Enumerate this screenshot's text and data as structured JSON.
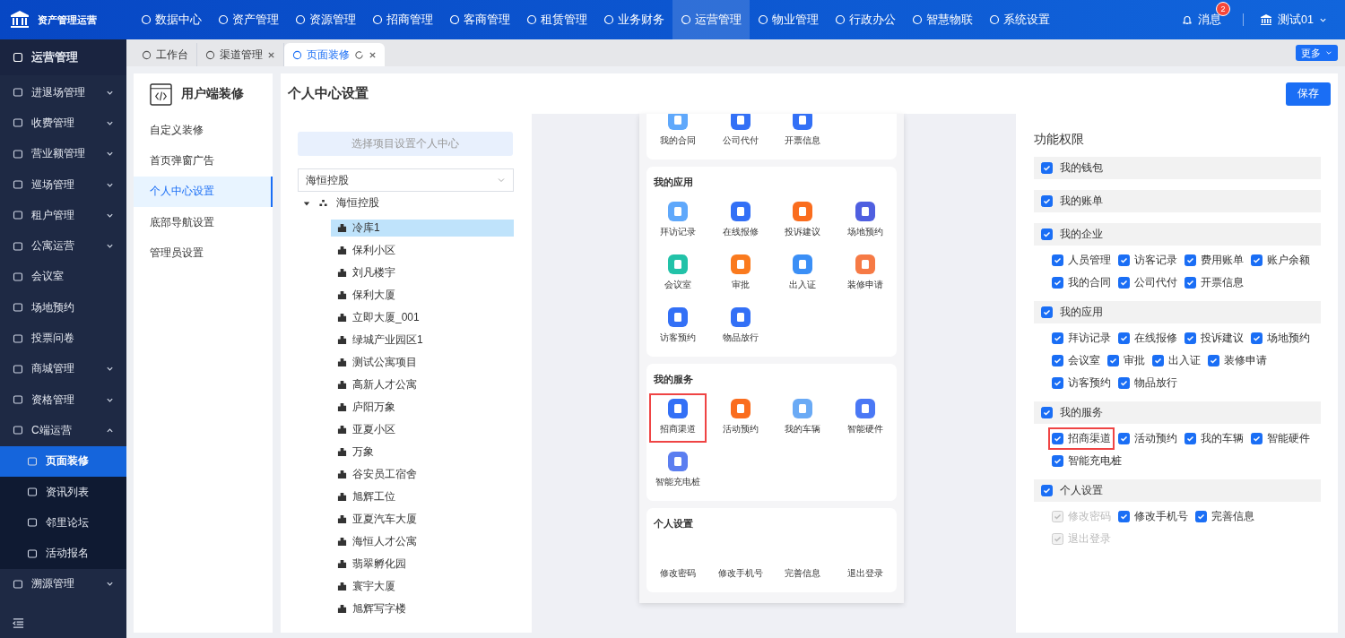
{
  "app": {
    "title": "资产管理运营"
  },
  "top_nav": [
    {
      "label": "数据中心",
      "selected": false
    },
    {
      "label": "资产管理",
      "selected": false
    },
    {
      "label": "资源管理",
      "selected": false
    },
    {
      "label": "招商管理",
      "selected": false
    },
    {
      "label": "客商管理",
      "selected": false
    },
    {
      "label": "租赁管理",
      "selected": false
    },
    {
      "label": "业务财务",
      "selected": false
    },
    {
      "label": "运营管理",
      "selected": true
    },
    {
      "label": "物业管理",
      "selected": false
    },
    {
      "label": "行政办公",
      "selected": false
    },
    {
      "label": "智慧物联",
      "selected": false
    },
    {
      "label": "系统设置",
      "selected": false
    }
  ],
  "header_right": {
    "messages": "消息",
    "badge": "2",
    "user": "测试01"
  },
  "sidebar": {
    "title": "运营管理",
    "items": [
      {
        "label": "进退场管理",
        "kind": "group",
        "expanded": false,
        "selected": false
      },
      {
        "label": "收费管理",
        "kind": "group",
        "expanded": false,
        "selected": false
      },
      {
        "label": "营业额管理",
        "kind": "group",
        "expanded": false,
        "selected": false
      },
      {
        "label": "巡场管理",
        "kind": "group",
        "expanded": false,
        "selected": false
      },
      {
        "label": "租户管理",
        "kind": "group",
        "expanded": false,
        "selected": false
      },
      {
        "label": "公寓运营",
        "kind": "group",
        "expanded": false,
        "selected": false
      },
      {
        "label": "会议室",
        "kind": "link",
        "selected": false
      },
      {
        "label": "场地预约",
        "kind": "link",
        "selected": false
      },
      {
        "label": "投票问卷",
        "kind": "link",
        "selected": false
      },
      {
        "label": "商城管理",
        "kind": "group",
        "expanded": false,
        "selected": false
      },
      {
        "label": "资格管理",
        "kind": "group",
        "expanded": false,
        "selected": false
      },
      {
        "label": "C端运营",
        "kind": "group",
        "expanded": true,
        "selected": false,
        "children": [
          {
            "label": "页面装修",
            "selected": true
          },
          {
            "label": "资讯列表",
            "selected": false
          },
          {
            "label": "邻里论坛",
            "selected": false
          },
          {
            "label": "活动报名",
            "selected": false
          }
        ]
      },
      {
        "label": "溯源管理",
        "kind": "group",
        "expanded": false,
        "selected": false
      }
    ]
  },
  "tabs": [
    {
      "label": "工作台",
      "selected": false,
      "closable": false
    },
    {
      "label": "渠道管理",
      "selected": false,
      "closable": true
    },
    {
      "label": "页面装修",
      "selected": true,
      "closable": true
    }
  ],
  "more_button": "更多",
  "decor_menu": {
    "title": "用户端装修",
    "items": [
      {
        "label": "自定义装修",
        "selected": false
      },
      {
        "label": "首页弹窗广告",
        "selected": false
      },
      {
        "label": "个人中心设置",
        "selected": true
      },
      {
        "label": "底部导航设置",
        "selected": false
      },
      {
        "label": "管理员设置",
        "selected": false
      }
    ]
  },
  "page": {
    "title": "个人中心设置",
    "save_button": "保存"
  },
  "project_panel": {
    "button": "选择项目设置个人中心",
    "select_value": "海恒控股",
    "tree": [
      {
        "label": "海恒控股",
        "expanded": true,
        "children": [
          {
            "label": "冷库1",
            "selected": true
          },
          {
            "label": "保利小区",
            "selected": false
          },
          {
            "label": "刘凡楼宇",
            "selected": false
          },
          {
            "label": "保利大厦",
            "selected": false
          },
          {
            "label": "立即大厦_001",
            "selected": false
          },
          {
            "label": "绿城产业园区1",
            "selected": false
          },
          {
            "label": "测试公寓项目",
            "selected": false
          },
          {
            "label": "高新人才公寓",
            "selected": false
          },
          {
            "label": "庐阳万象",
            "selected": false
          },
          {
            "label": "亚夏小区",
            "selected": false
          },
          {
            "label": "万象",
            "selected": false
          },
          {
            "label": "谷安员工宿舍",
            "selected": false
          },
          {
            "label": "旭辉工位",
            "selected": false
          },
          {
            "label": "亚夏汽车大厦",
            "selected": false
          },
          {
            "label": "海恒人才公寓",
            "selected": false
          },
          {
            "label": "翡翠孵化园",
            "selected": false
          },
          {
            "label": "寰宇大厦",
            "selected": false
          },
          {
            "label": "旭辉写字楼",
            "selected": false
          }
        ]
      }
    ]
  },
  "phone_preview": {
    "sections": [
      {
        "items": [
          {
            "label": "我的合同",
            "color": "#5fa8fb",
            "highlighted": false
          },
          {
            "label": "公司代付",
            "color": "#3370f6",
            "highlighted": false
          },
          {
            "label": "开票信息",
            "color": "#3370f6",
            "highlighted": false
          }
        ]
      },
      {
        "title": "我的应用",
        "items": [
          {
            "label": "拜访记录",
            "color": "#5fa8fb",
            "highlighted": false
          },
          {
            "label": "在线报修",
            "color": "#3370f6",
            "highlighted": false
          },
          {
            "label": "投诉建议",
            "color": "#fa6d1e",
            "highlighted": false
          },
          {
            "label": "场地预约",
            "color": "#4f5fe0",
            "highlighted": false
          },
          {
            "label": "会议室",
            "color": "#22c2a8",
            "highlighted": false
          },
          {
            "label": "审批",
            "color": "#fa7a1e",
            "highlighted": false
          },
          {
            "label": "出入证",
            "color": "#3b8ff6",
            "highlighted": false
          },
          {
            "label": "装修申请",
            "color": "#f67a45",
            "highlighted": false
          },
          {
            "label": "访客预约",
            "color": "#3370f6",
            "highlighted": false
          },
          {
            "label": "物品放行",
            "color": "#3370f6",
            "highlighted": false
          }
        ]
      },
      {
        "title": "我的服务",
        "items": [
          {
            "label": "招商渠道",
            "color": "#3370f6",
            "highlighted": true
          },
          {
            "label": "活动预约",
            "color": "#fa6d1e",
            "highlighted": false
          },
          {
            "label": "我的车辆",
            "color": "#6aaaf5",
            "highlighted": false
          },
          {
            "label": "智能硬件",
            "color": "#4a78f5",
            "highlighted": false
          },
          {
            "label": "智能充电桩",
            "color": "#5b7ef0",
            "highlighted": false
          }
        ]
      },
      {
        "title": "个人设置",
        "items": [
          {
            "label": "修改密码",
            "highlighted": false
          },
          {
            "label": "修改手机号",
            "highlighted": false
          },
          {
            "label": "完善信息",
            "highlighted": false
          },
          {
            "label": "退出登录",
            "highlighted": false
          }
        ]
      }
    ]
  },
  "permissions": {
    "title": "功能权限",
    "groups": [
      {
        "label": "我的钱包",
        "checked": true
      },
      {
        "label": "我的账单",
        "checked": true
      },
      {
        "label": "我的企业",
        "checked": true,
        "children": [
          {
            "label": "人员管理",
            "checked": true,
            "disabled": false,
            "highlighted": false
          },
          {
            "label": "访客记录",
            "checked": true,
            "disabled": false,
            "highlighted": false
          },
          {
            "label": "费用账单",
            "checked": true,
            "disabled": false,
            "highlighted": false
          },
          {
            "label": "账户余额",
            "checked": true,
            "disabled": false,
            "highlighted": false
          },
          {
            "label": "我的合同",
            "checked": true,
            "disabled": false,
            "highlighted": false
          },
          {
            "label": "公司代付",
            "checked": true,
            "disabled": false,
            "highlighted": false
          },
          {
            "label": "开票信息",
            "checked": true,
            "disabled": false,
            "highlighted": false
          }
        ]
      },
      {
        "label": "我的应用",
        "checked": true,
        "children": [
          {
            "label": "拜访记录",
            "checked": true,
            "disabled": false,
            "highlighted": false
          },
          {
            "label": "在线报修",
            "checked": true,
            "disabled": false,
            "highlighted": false
          },
          {
            "label": "投诉建议",
            "checked": true,
            "disabled": false,
            "highlighted": false
          },
          {
            "label": "场地预约",
            "checked": true,
            "disabled": false,
            "highlighted": false
          },
          {
            "label": "会议室",
            "checked": true,
            "disabled": false,
            "highlighted": false
          },
          {
            "label": "审批",
            "checked": true,
            "disabled": false,
            "highlighted": false
          },
          {
            "label": "出入证",
            "checked": true,
            "disabled": false,
            "highlighted": false
          },
          {
            "label": "装修申请",
            "checked": true,
            "disabled": false,
            "highlighted": false
          },
          {
            "label": "访客预约",
            "checked": true,
            "disabled": false,
            "highlighted": false
          },
          {
            "label": "物品放行",
            "checked": true,
            "disabled": false,
            "highlighted": false
          }
        ]
      },
      {
        "label": "我的服务",
        "checked": true,
        "children": [
          {
            "label": "招商渠道",
            "checked": true,
            "disabled": false,
            "highlighted": true
          },
          {
            "label": "活动预约",
            "checked": true,
            "disabled": false,
            "highlighted": false
          },
          {
            "label": "我的车辆",
            "checked": true,
            "disabled": false,
            "highlighted": false
          },
          {
            "label": "智能硬件",
            "checked": true,
            "disabled": false,
            "highlighted": false
          },
          {
            "label": "智能充电桩",
            "checked": true,
            "disabled": false,
            "highlighted": false
          }
        ]
      },
      {
        "label": "个人设置",
        "checked": true,
        "children": [
          {
            "label": "修改密码",
            "checked": true,
            "disabled": true,
            "highlighted": false
          },
          {
            "label": "修改手机号",
            "checked": true,
            "disabled": false,
            "highlighted": false
          },
          {
            "label": "完善信息",
            "checked": true,
            "disabled": false,
            "highlighted": false
          },
          {
            "label": "退出登录",
            "checked": true,
            "disabled": true,
            "highlighted": false
          }
        ]
      }
    ]
  }
}
